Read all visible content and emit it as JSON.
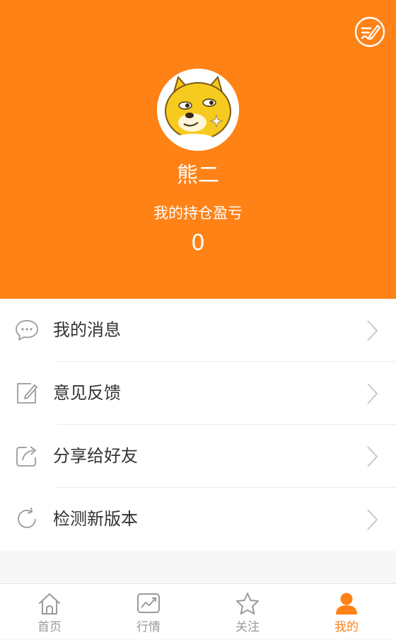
{
  "profile": {
    "username": "熊二",
    "holdings_label": "我的持仓盈亏",
    "holdings_value": "0"
  },
  "menu": {
    "items": [
      {
        "label": "我的消息",
        "icon": "message-icon"
      },
      {
        "label": "意见反馈",
        "icon": "feedback-edit-icon"
      },
      {
        "label": "分享给好友",
        "icon": "share-icon"
      },
      {
        "label": "检测新版本",
        "icon": "refresh-icon"
      }
    ]
  },
  "tabbar": {
    "tabs": [
      {
        "label": "首页",
        "icon": "home-icon",
        "active": false
      },
      {
        "label": "行情",
        "icon": "chart-icon",
        "active": false
      },
      {
        "label": "关注",
        "icon": "star-icon",
        "active": false
      },
      {
        "label": "我的",
        "icon": "user-icon",
        "active": true
      }
    ]
  },
  "colors": {
    "brand": "#ff8217",
    "text": "#333333",
    "muted": "#9a9a9a",
    "divider": "#ececec"
  }
}
